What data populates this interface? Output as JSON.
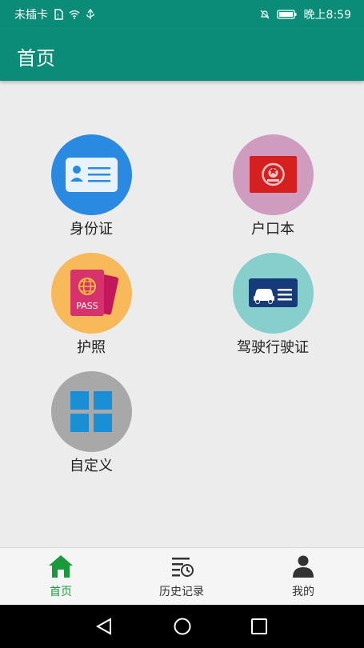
{
  "status_bar": {
    "carrier": "未插卡",
    "time": "晚上8:59"
  },
  "app_bar": {
    "title": "首页"
  },
  "grid": [
    {
      "label": "身份证",
      "icon": "id-card-icon",
      "color": "#2a89e0"
    },
    {
      "label": "户口本",
      "icon": "household-register-icon",
      "color": "#cf9cbf"
    },
    {
      "label": "护照",
      "icon": "passport-icon",
      "color": "#f7b95a"
    },
    {
      "label": "驾驶行驶证",
      "icon": "vehicle-license-icon",
      "color": "#86cfcd"
    },
    {
      "label": "自定义",
      "icon": "custom-grid-icon",
      "color": "#a8a8a8"
    }
  ],
  "bottom_nav": [
    {
      "label": "首页",
      "icon": "home-icon",
      "active": true
    },
    {
      "label": "历史记录",
      "icon": "history-icon",
      "active": false
    },
    {
      "label": "我的",
      "icon": "person-icon",
      "active": false
    }
  ],
  "colors": {
    "primary": "#0a8c79",
    "active_nav": "#1a9a3a"
  }
}
